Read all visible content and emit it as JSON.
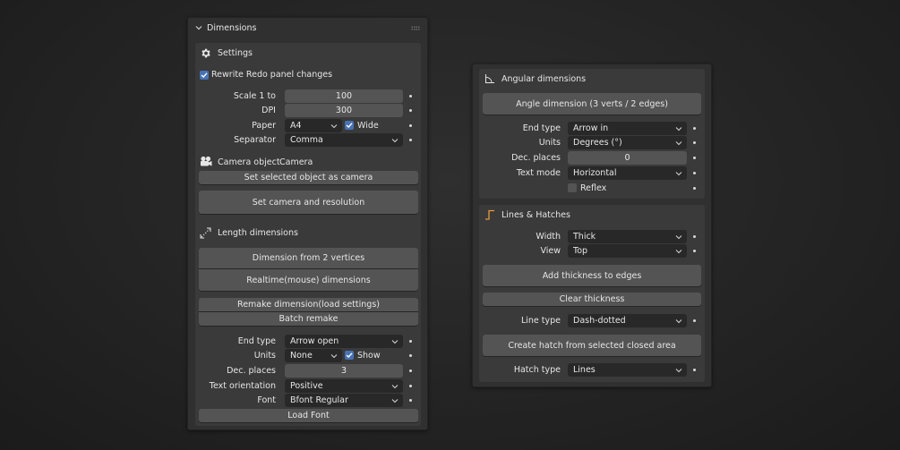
{
  "left": {
    "title": "Dimensions",
    "settings": {
      "header": "Settings",
      "rewrite_label": "Rewrite Redo panel changes",
      "rewrite_checked": true,
      "scale_label": "Scale 1 to",
      "scale_value": "100",
      "dpi_label": "DPI",
      "dpi_value": "300",
      "paper_label": "Paper",
      "paper_value": "A4",
      "wide_label": "Wide",
      "wide_checked": true,
      "separator_label": "Separator",
      "separator_value": "Comma",
      "camera_label": "Camera object",
      "camera_value": "Camera",
      "set_camera_button": "Set selected object as camera",
      "set_camera_res_button": "Set camera and resolution"
    },
    "length": {
      "header": "Length dimensions",
      "dim_2_vertices": "Dimension from 2 vertices",
      "realtime": "Realtime(mouse) dimensions",
      "remake": "Remake dimension(load settings)",
      "batch_remake": "Batch remake",
      "end_type_label": "End type",
      "end_type_value": "Arrow open",
      "units_label": "Units",
      "units_value": "None",
      "show_label": "Show",
      "show_checked": true,
      "dec_label": "Dec. places",
      "dec_value": "3",
      "orient_label": "Text orientation",
      "orient_value": "Positive",
      "font_label": "Font",
      "font_value": "Bfont Regular",
      "load_font": "Load Font"
    }
  },
  "right": {
    "angular": {
      "header": "Angular dimensions",
      "angle_button": "Angle dimension (3 verts / 2 edges)",
      "end_type_label": "End type",
      "end_type_value": "Arrow in",
      "units_label": "Units",
      "units_value": "Degrees (°)",
      "dec_label": "Dec. places",
      "dec_value": "0",
      "text_mode_label": "Text mode",
      "text_mode_value": "Horizontal",
      "reflex_label": "Reflex",
      "reflex_checked": false
    },
    "lines": {
      "header": "Lines & Hatches",
      "width_label": "Width",
      "width_value": "Thick",
      "view_label": "View",
      "view_value": "Top",
      "add_thickness": "Add thickness to edges",
      "clear_thickness": "Clear thickness",
      "line_type_label": "Line type",
      "line_type_value": "Dash-dotted",
      "create_hatch": "Create hatch from selected closed area",
      "hatch_type_label": "Hatch type",
      "hatch_type_value": "Lines"
    }
  },
  "colors": {
    "accent": "#4772b3",
    "panel_bg": "#303030",
    "subpanel_bg": "#3a3a3a",
    "button_bg": "#545454",
    "dropdown_bg": "#282828",
    "hatch_icon": "#e69a3c"
  },
  "icons": [
    "chevron-down-icon",
    "gear-icon",
    "checkmark-icon",
    "camera-icon",
    "length-icon",
    "angle-icon",
    "lines-icon",
    "caret-down-icon",
    "decorate-dot-icon"
  ]
}
